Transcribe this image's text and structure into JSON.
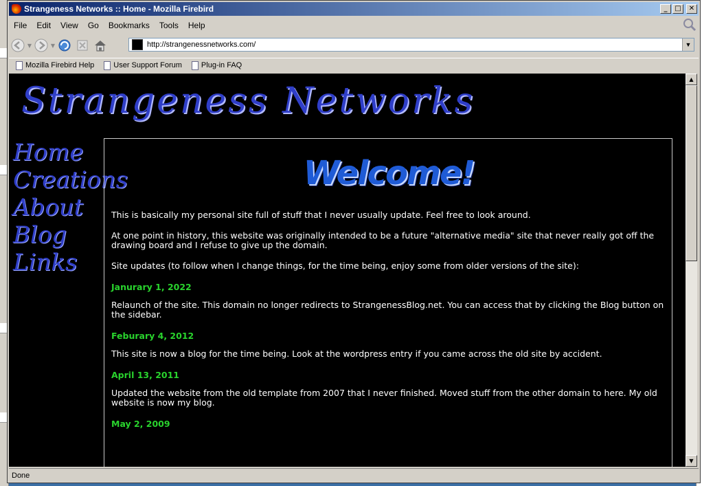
{
  "window": {
    "title": "Strangeness Networks :: Home - Mozilla Firebird"
  },
  "menu": [
    "File",
    "Edit",
    "View",
    "Go",
    "Bookmarks",
    "Tools",
    "Help"
  ],
  "address": {
    "url": "http://strangenessnetworks.com/"
  },
  "bookmarks": [
    "Mozilla Firebird Help",
    "User Support Forum",
    "Plug-in FAQ"
  ],
  "status": "Done",
  "page": {
    "site_title": "Strangeness Networks",
    "nav": [
      "Home",
      "Creations",
      "About",
      "Blog",
      "Links"
    ],
    "welcome": "Welcome!",
    "intro": [
      "This is basically my personal site full of stuff that I never usually update. Feel free to look around.",
      "At one point in history, this website was originally intended to be a future \"alternative media\" site that never really got off the drawing board and I refuse to give up the domain.",
      "Site updates (to follow when I change things, for the time being, enjoy some from older versions of the site):"
    ],
    "updates": [
      {
        "date": "Janurary 1, 2022",
        "text": "Relaunch of the site. This domain no longer redirects to StrangenessBlog.net. You can access that by clicking the Blog button on the sidebar."
      },
      {
        "date": "Feburary 4, 2012",
        "text": "This site is now a blog for the time being. Look at the wordpress entry if you came across the old site by accident."
      },
      {
        "date": "April 13, 2011",
        "text": "Updated the website from the old template from 2007 that I never finished. Moved stuff from the other domain to here. My old website is now my blog."
      },
      {
        "date": "May 2, 2009",
        "text": ""
      }
    ]
  }
}
